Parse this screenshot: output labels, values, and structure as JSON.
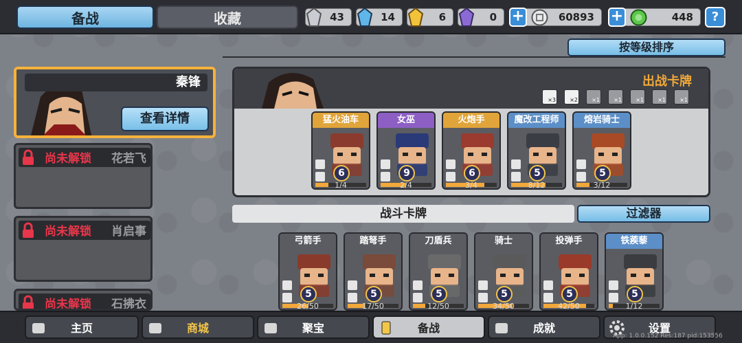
{
  "top": {
    "tab_prepare": "备战",
    "tab_collection": "收藏",
    "resources": [
      {
        "icon": "silver-crystal-icon",
        "value": "43",
        "color": "#b9bcc2"
      },
      {
        "icon": "blue-crystal-icon",
        "value": "14",
        "color": "#5fb6e8"
      },
      {
        "icon": "gold-crystal-icon",
        "value": "6",
        "color": "#f2c23a"
      },
      {
        "icon": "purple-crystal-icon",
        "value": "0",
        "color": "#8c6ad6"
      }
    ],
    "coins": {
      "icon": "silver-coin-icon",
      "value": "60893"
    },
    "gems": {
      "icon": "green-gem-icon",
      "value": "448"
    },
    "plus": "+",
    "help": "?"
  },
  "sort_label": "按等级排序",
  "heroes": {
    "selected": {
      "name": "秦锋",
      "detail_label": "查看详情"
    },
    "locked": [
      {
        "status": "尚未解锁",
        "name": "花若飞"
      },
      {
        "status": "尚未解锁",
        "name": "肖启事"
      },
      {
        "status": "尚未解锁",
        "name": "石拂衣"
      }
    ]
  },
  "deck": {
    "title": "出战卡牌",
    "slots": [
      "×3",
      "×2",
      "×1",
      "×1",
      "×1",
      "×1",
      "×1"
    ],
    "cards": [
      {
        "name": "猛火油车",
        "level": "6",
        "count": "1/4",
        "progress": 0.25,
        "header_color": "#e0a43a",
        "art_color": "#8b3b2e"
      },
      {
        "name": "女巫",
        "level": "9",
        "count": "2/4",
        "progress": 0.5,
        "header_color": "#8d5fc4",
        "art_color": "#2a3a78"
      },
      {
        "name": "火炮手",
        "level": "6",
        "count": "3/4",
        "progress": 0.75,
        "header_color": "#e0a43a",
        "art_color": "#9b3a2e"
      },
      {
        "name": "魔改工程师",
        "level": "5",
        "count": "8/12",
        "progress": 0.67,
        "header_color": "#5c8fc8",
        "art_color": "#3a3d44"
      },
      {
        "name": "熔岩骑士",
        "level": "5",
        "count": "3/12",
        "progress": 0.25,
        "header_color": "#5c8fc8",
        "art_color": "#a84a26"
      }
    ]
  },
  "battle": {
    "title": "战斗卡牌",
    "filter_label": "过滤器",
    "cards": [
      {
        "name": "弓箭手",
        "level": "5",
        "count": "26/50",
        "progress": 0.52,
        "header_color": "#5a5c62",
        "art_color": "#8a3a2a"
      },
      {
        "name": "踏弩手",
        "level": "5",
        "count": "17/50",
        "progress": 0.34,
        "header_color": "#5a5c62",
        "art_color": "#7a4a3a"
      },
      {
        "name": "刀盾兵",
        "level": "5",
        "count": "12/50",
        "progress": 0.24,
        "header_color": "#5a5c62",
        "art_color": "#6a6a6a"
      },
      {
        "name": "骑士",
        "level": "5",
        "count": "34/50",
        "progress": 0.68,
        "header_color": "#5a5c62",
        "art_color": "#5a5a5a"
      },
      {
        "name": "投弹手",
        "level": "5",
        "count": "42/50",
        "progress": 0.84,
        "header_color": "#5a5c62",
        "art_color": "#9a3a2a"
      },
      {
        "name": "铁蒺藜",
        "level": "5",
        "count": "1/12",
        "progress": 0.08,
        "header_color": "#5c8fc8",
        "art_color": "#3a3c40"
      }
    ]
  },
  "nav": [
    {
      "label": "主页",
      "icon": "home-icon",
      "active": false
    },
    {
      "label": "商城",
      "icon": "coins-icon",
      "active": false
    },
    {
      "label": "聚宝",
      "icon": "treasure-eye-icon",
      "active": false
    },
    {
      "label": "备战",
      "icon": "cards-icon",
      "active": true
    },
    {
      "label": "成就",
      "icon": "achievement-icon",
      "active": false
    },
    {
      "label": "设置",
      "icon": "gear-icon",
      "active": false
    }
  ],
  "version_text": "App: 1.0.0.152 Res:187 pid:153556"
}
